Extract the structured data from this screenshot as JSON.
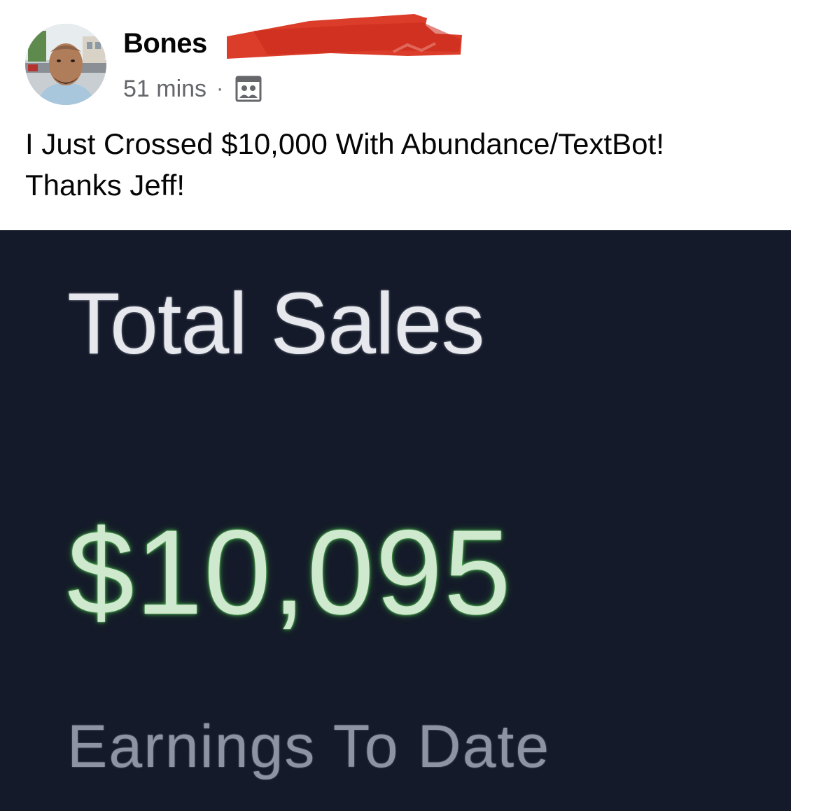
{
  "post": {
    "author_name": "Bones",
    "timestamp": "51 mins",
    "separator": "·",
    "audience_icon": "group-icon",
    "text_line_1": "I Just Crossed $10,000 With Abundance/TextBot!",
    "text_line_2": "Thanks Jeff!"
  },
  "sales_card": {
    "title": "Total Sales",
    "amount": "$10,095",
    "subtitle": "Earnings To Date",
    "background_color": "#141a29",
    "amount_color": "#cfe9cf",
    "amount_glow_color": "#5ec25e"
  },
  "colors": {
    "redaction": "#d9331f",
    "meta_text": "#65676b"
  }
}
